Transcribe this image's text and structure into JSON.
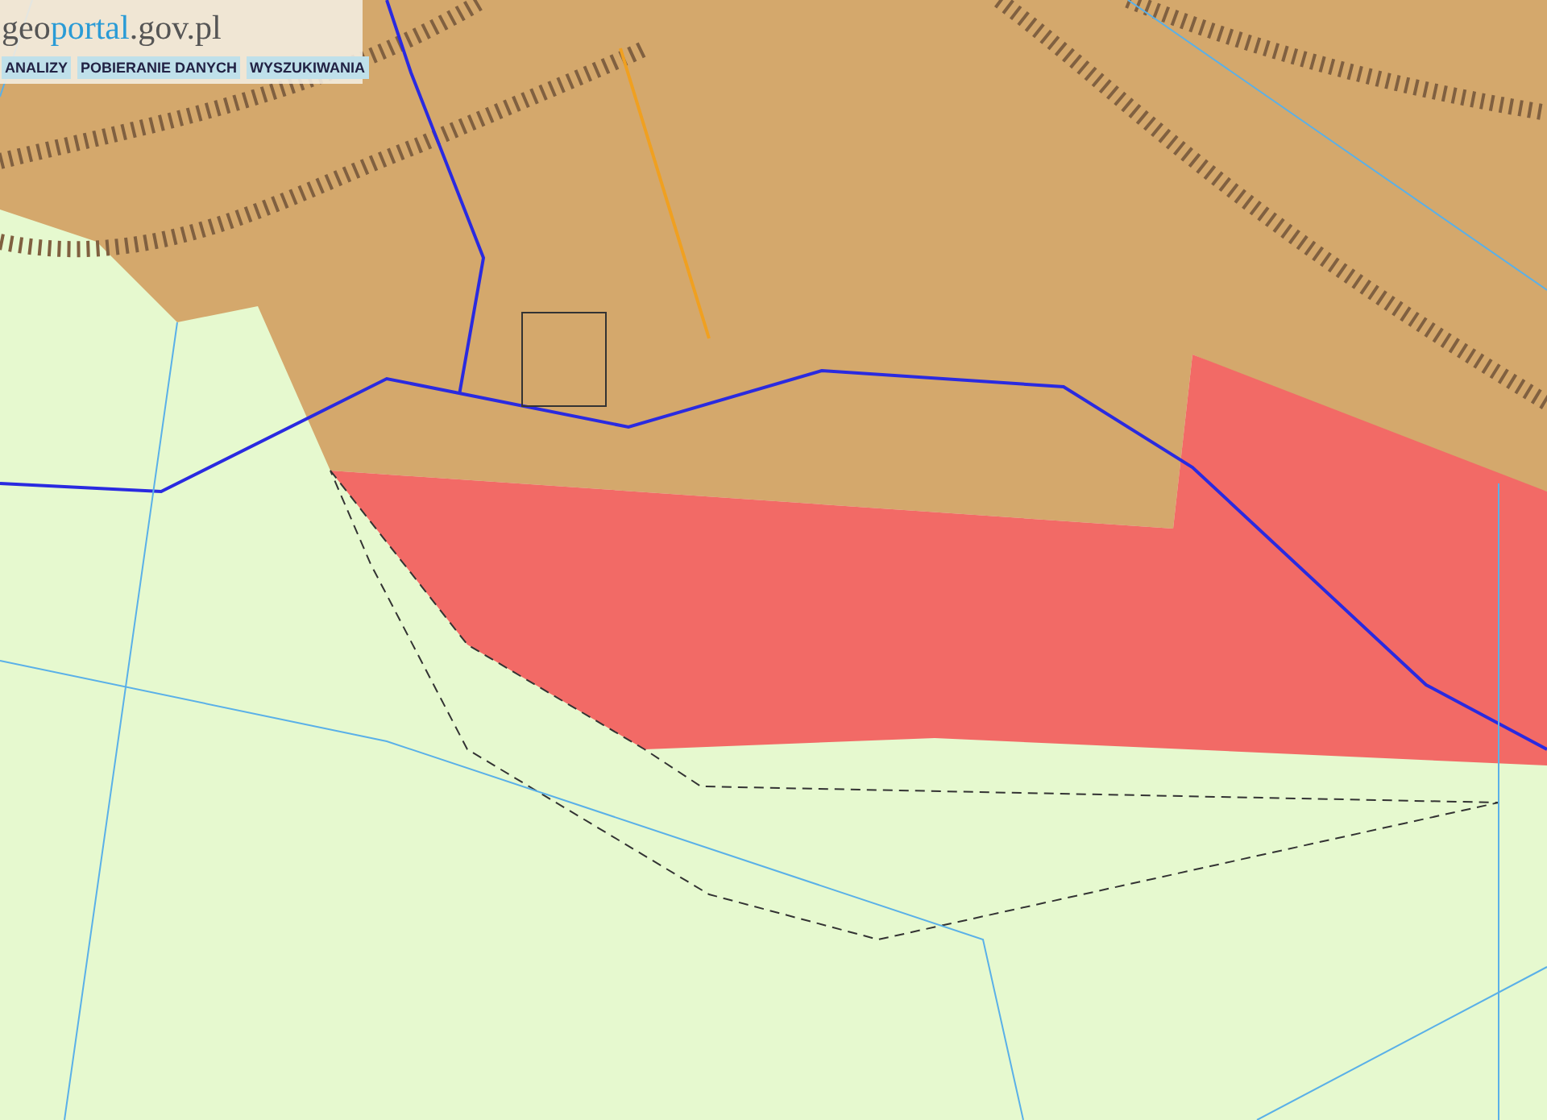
{
  "logo": {
    "prefix": "geo",
    "highlight": "portal",
    "suffix": ".gov.pl"
  },
  "toolbar": [
    "ANALIZY",
    "POBIERANIE DANYCH",
    "WYSZUKIWANIA"
  ]
}
